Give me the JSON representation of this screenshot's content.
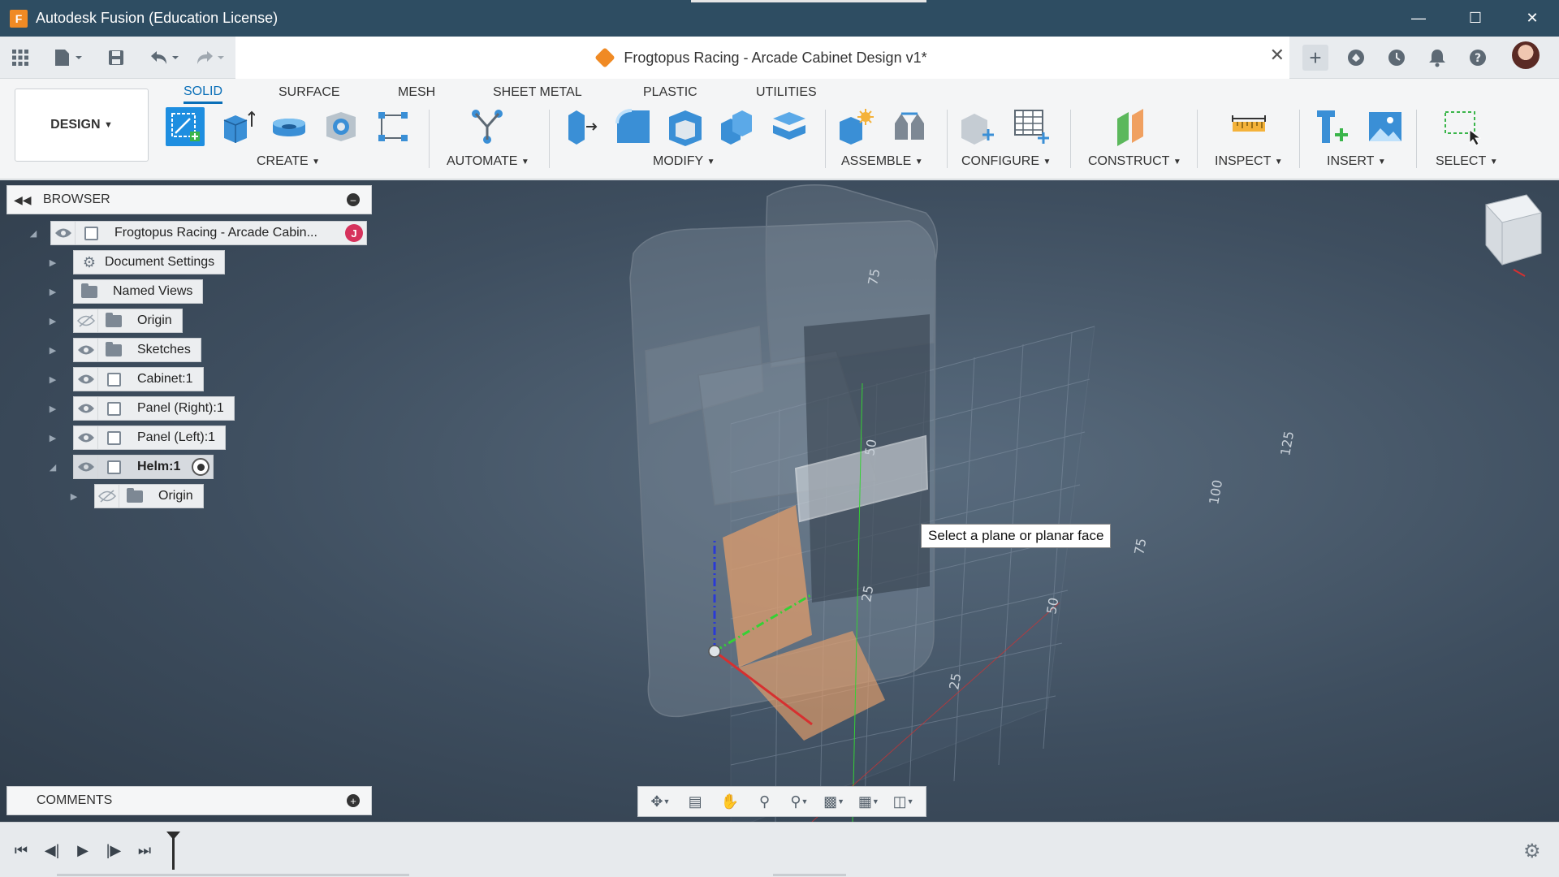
{
  "window": {
    "title": "Autodesk Fusion (Education License)",
    "logo_letter": "F",
    "controls": [
      "minimize",
      "maximize",
      "close"
    ]
  },
  "document_tab": {
    "title": "Frogtopus Racing - Arcade Cabinet Design v1*"
  },
  "ribbon": {
    "workspace": "DESIGN",
    "tabs": [
      "SOLID",
      "SURFACE",
      "MESH",
      "SHEET METAL",
      "PLASTIC",
      "UTILITIES"
    ],
    "active_tab": "SOLID",
    "groups": [
      "CREATE",
      "AUTOMATE",
      "MODIFY",
      "ASSEMBLE",
      "CONFIGURE",
      "CONSTRUCT",
      "INSPECT",
      "INSERT",
      "SELECT"
    ]
  },
  "browser": {
    "title": "BROWSER",
    "root": "Frogtopus Racing - Arcade Cabin...",
    "root_badge": "J",
    "items": [
      {
        "label": "Document Settings",
        "icon": "gear-icon"
      },
      {
        "label": "Named Views",
        "icon": "folder-icon"
      },
      {
        "label": "Origin",
        "icon": "folder-icon",
        "hidden": true
      },
      {
        "label": "Sketches",
        "icon": "folder-icon"
      },
      {
        "label": "Cabinet:1",
        "icon": "component-icon"
      },
      {
        "label": "Panel (Right):1",
        "icon": "component-icon"
      },
      {
        "label": "Panel (Left):1",
        "icon": "component-icon"
      },
      {
        "label": "Helm:1",
        "icon": "component-icon",
        "active": true
      },
      {
        "label": "Origin",
        "icon": "folder-icon",
        "hidden": true
      }
    ]
  },
  "comments": {
    "title": "COMMENTS"
  },
  "viewport": {
    "tooltip": "Select a plane or planar face",
    "grid_labels": [
      "75",
      "50",
      "25",
      "125",
      "100",
      "75",
      "50",
      "25"
    ]
  },
  "colors": {
    "titlebar": "#2e4d62",
    "accent": "#0a6fb8",
    "brand_orange": "#f08a24"
  }
}
